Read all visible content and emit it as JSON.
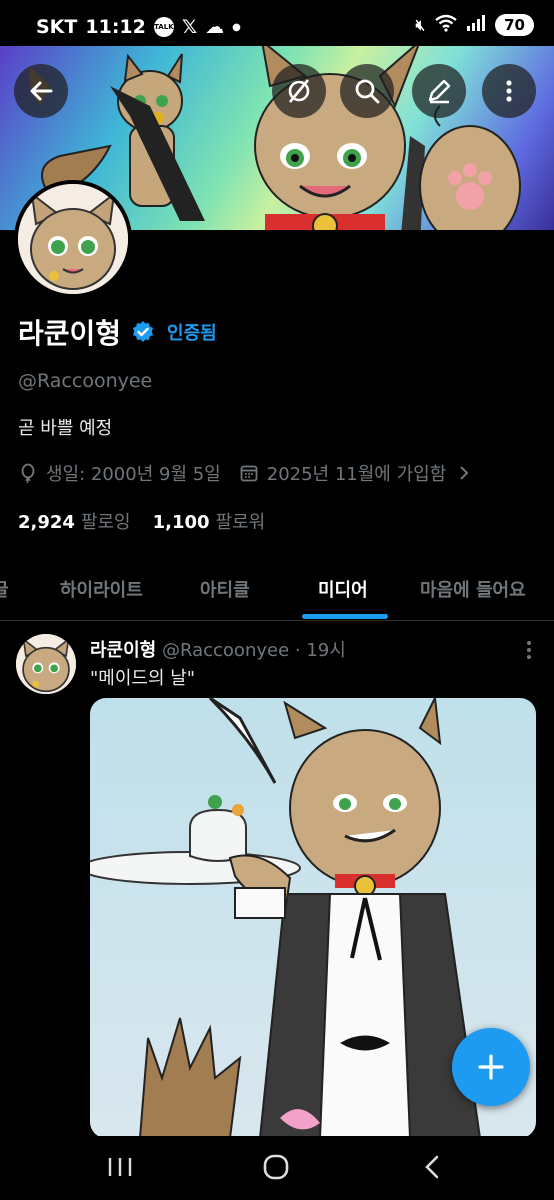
{
  "status_bar": {
    "carrier": "SKT",
    "time": "11:12",
    "talk_badge": "TALK",
    "battery": "70"
  },
  "header": {
    "back_icon": "arrow-left-icon",
    "grok_icon": "grok-icon",
    "search_icon": "search-icon",
    "edit_icon": "pencil-icon",
    "more_icon": "more-vertical-icon"
  },
  "profile": {
    "display_name": "라쿤이형",
    "verified_label": "인증됨",
    "handle": "@Raccoonyee",
    "bio": "곧 바쁠 예정",
    "birthday": "생일: 2000년 9월 5일",
    "joined": "2025년 11월에 가입함",
    "following_count": "2,924",
    "following_label": "팔로잉",
    "followers_count": "1,100",
    "followers_label": "팔로워"
  },
  "tabs": [
    {
      "label": "글"
    },
    {
      "label": "하이라이트"
    },
    {
      "label": "아티클"
    },
    {
      "label": "미디어"
    },
    {
      "label": "마음에 들어요"
    }
  ],
  "active_tab": "미디어",
  "post": {
    "author": "라쿤이형",
    "handle": "@Raccoonyee",
    "separator": "·",
    "time": "19시",
    "text": "\"메이드의 날\""
  },
  "colors": {
    "accent": "#1d9bf0",
    "background": "#000000",
    "secondary_text": "#71767b"
  }
}
